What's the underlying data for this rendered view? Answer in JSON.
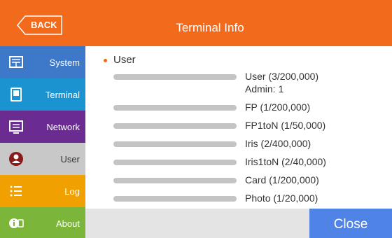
{
  "header": {
    "back_label": "BACK",
    "title": "Terminal Info",
    "bg_color": "#f26a1b"
  },
  "sidebar": {
    "items": [
      {
        "label": "System",
        "icon": "system-icon",
        "color": "#3d79c8"
      },
      {
        "label": "Terminal",
        "icon": "terminal-icon",
        "color": "#1a93d0"
      },
      {
        "label": "Network",
        "icon": "network-icon",
        "color": "#6a2c91"
      },
      {
        "label": "User",
        "icon": "user-icon",
        "color": "#c8c8c8",
        "selected": true
      },
      {
        "label": "Log",
        "icon": "log-icon",
        "color": "#f0a000"
      },
      {
        "label": "About",
        "icon": "about-icon",
        "color": "#7bb63b"
      }
    ]
  },
  "content": {
    "section": "User",
    "rows": [
      {
        "text": "User (3/200,000)",
        "sub": "Admin: 1"
      },
      {
        "text": "FP (1/200,000)"
      },
      {
        "text": "FP1toN (1/50,000)"
      },
      {
        "text": "Iris (2/400,000)"
      },
      {
        "text": "Iris1toN (2/40,000)"
      },
      {
        "text": "Card (1/200,000)"
      },
      {
        "text": "Photo (1/20,000)"
      }
    ]
  },
  "footer": {
    "close_label": "Close",
    "close_color": "#4f83e6"
  }
}
